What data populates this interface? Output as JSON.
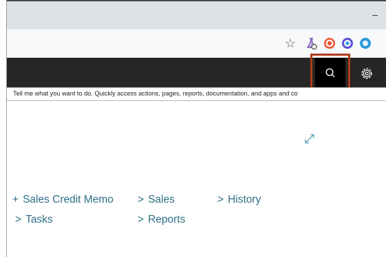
{
  "window": {
    "minimize_glyph": "–"
  },
  "toolbar": {
    "bookmark_icon": "star-icon",
    "extensions": [
      "flask-extension-icon",
      "target-extension-icon",
      "swirl-extension-icon",
      "blue-extension-icon"
    ]
  },
  "appbar": {
    "search_icon": "search-icon",
    "settings_icon": "gear-icon",
    "highlight_color": "#b23a1b"
  },
  "search_hint": "Tell me what you want to do. Quickly access actions, pages, reports, documentation, and apps and co",
  "content": {
    "expand_icon": "expand-icon",
    "actions": [
      {
        "label": "Sales Credit Memo",
        "glyph": "+"
      },
      {
        "label": "Sales",
        "glyph": ">"
      },
      {
        "label": "History",
        "glyph": ">"
      },
      {
        "label": "Tasks",
        "glyph": ">"
      },
      {
        "label": "Reports",
        "glyph": ">"
      }
    ],
    "link_color": "#2d6f85"
  }
}
